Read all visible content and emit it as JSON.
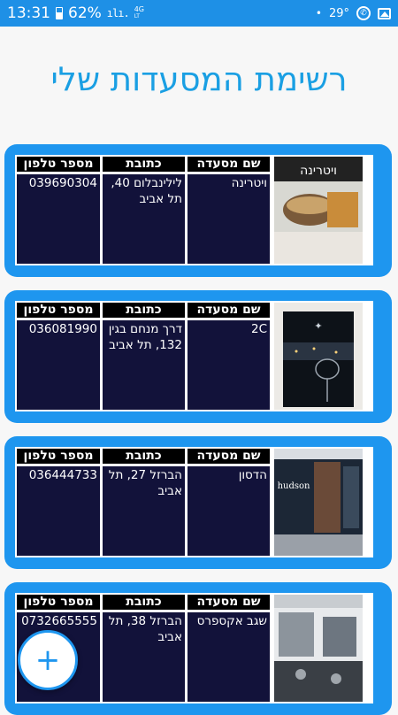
{
  "status_bar": {
    "time": "13:31",
    "battery": "62%",
    "network": [
      "4G",
      "LT"
    ],
    "temperature": "29°",
    "icons": [
      "battery-icon",
      "signal-icon",
      "weather-dot-icon",
      "whatsapp-icon",
      "gallery-icon"
    ]
  },
  "page_title": "רשימת המסעדות שלי",
  "table_headers": {
    "name": "שם מסעדה",
    "address": "כתובת",
    "phone": "מספר טלפון"
  },
  "restaurants": [
    {
      "name": "ויטרינה",
      "address": "לילינבלום 40, תל אביב",
      "phone": "039690304",
      "image": "vitrina-photo"
    },
    {
      "name": "2C",
      "address": "דרך מנחם בגין 132, תל אביב",
      "phone": "036081990",
      "image": "city-view-photo"
    },
    {
      "name": "הדסון",
      "address": "הברזל 27, תל אביב",
      "phone": "036444733",
      "image": "hudson-photo"
    },
    {
      "name": "שגב אקספרס",
      "address": "הברזל 38, תל אביב",
      "phone": "0732665555",
      "image": "segev-photo"
    }
  ],
  "fab": {
    "label": "+"
  },
  "colors": {
    "accent": "#1e96ef",
    "title": "#1a9fe3",
    "cell": "#12123a",
    "header": "#000000"
  }
}
